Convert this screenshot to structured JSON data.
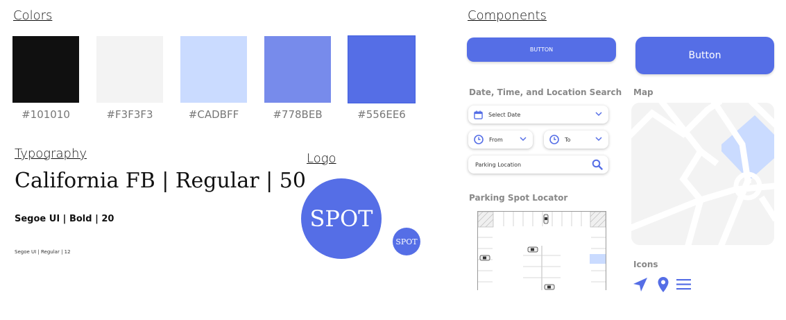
{
  "colors": {
    "heading": "Colors",
    "swatches": [
      {
        "hex": "#101010",
        "label": "#101010"
      },
      {
        "hex": "#F3F3F3",
        "label": "#F3F3F3"
      },
      {
        "hex": "#CADBFF",
        "label": "#CADBFF"
      },
      {
        "hex": "#778BEB",
        "label": "#778BEB"
      },
      {
        "hex": "#556EE6",
        "label": "#556EE6"
      }
    ]
  },
  "typography": {
    "heading": "Typography",
    "sample_large": "California FB | Regular | 50",
    "sample_medium": "Segoe UI | Bold | 20",
    "sample_small": "Segoe UI | Regular | 12"
  },
  "logo": {
    "heading": "Logo",
    "text_large": "SPOT",
    "text_small": "SPOT"
  },
  "components": {
    "heading": "Components",
    "button_small_label": "BUTTON",
    "button_large_label": "Button",
    "search": {
      "title": "Date, Time, and Location Search",
      "date_placeholder": "Select Date",
      "from_placeholder": "From",
      "to_placeholder": "To",
      "location_placeholder": "Parking Location"
    },
    "map": {
      "title": "Map"
    },
    "locator": {
      "title": "Parking Spot Locator"
    },
    "icons": {
      "title": "Icons",
      "items": [
        "navigation-arrow-icon",
        "location-pin-icon",
        "hamburger-menu-icon"
      ]
    }
  },
  "accent": "#556EE6"
}
